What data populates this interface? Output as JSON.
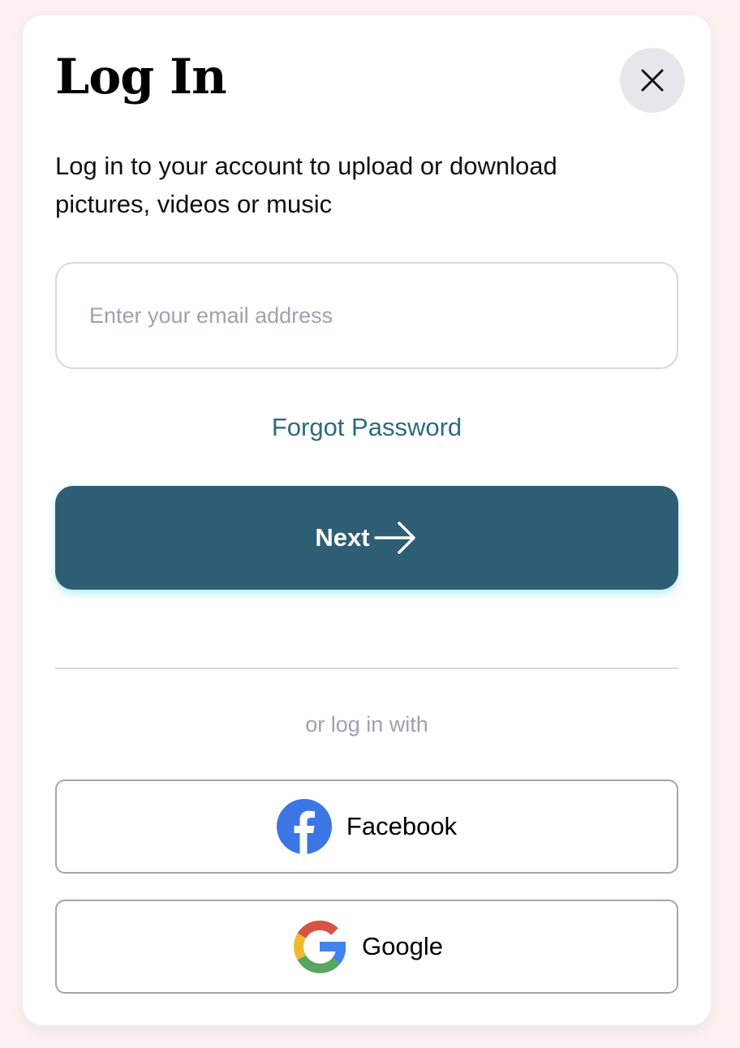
{
  "modal": {
    "title": "Log In",
    "subtitle": "Log in to your account to upload or download pictures, videos or music"
  },
  "close_button": {
    "icon": "close-icon"
  },
  "email": {
    "value": "",
    "placeholder": "Enter your email address"
  },
  "forgot_password": {
    "label": "Forgot Password"
  },
  "next_button": {
    "label": "Next",
    "icon": "arrow-right-icon"
  },
  "social": {
    "divider_text": "or log in with",
    "providers": [
      {
        "label": "Facebook",
        "icon": "facebook-icon"
      },
      {
        "label": "Google",
        "icon": "google-icon"
      }
    ]
  },
  "colors": {
    "background": "#fcf0f0",
    "primary": "#2e5e74",
    "link": "#2e6a80",
    "muted_text": "#9ca3af",
    "facebook_blue": "#3b76e4"
  }
}
